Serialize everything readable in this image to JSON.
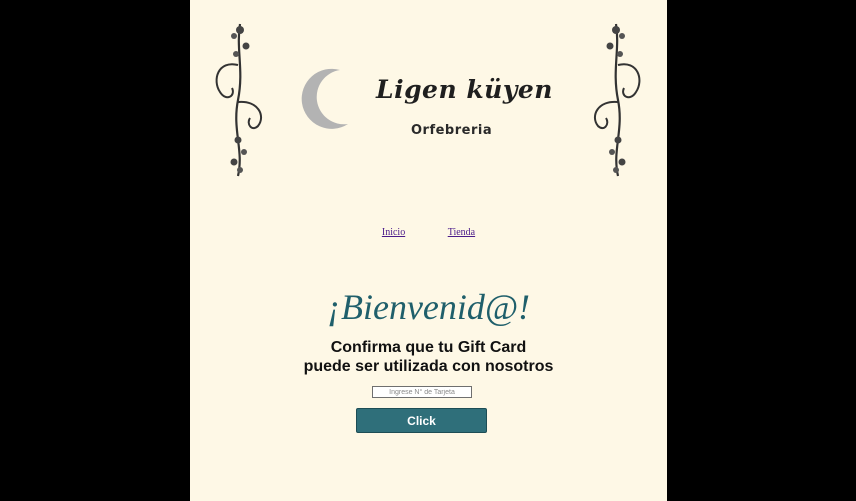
{
  "brand": {
    "name": "Ligen küyen",
    "tagline": "Orfebreria"
  },
  "nav": {
    "items": [
      {
        "label": "Inicio"
      },
      {
        "label": "Tienda"
      }
    ]
  },
  "main": {
    "welcome": "¡Bienvenid@!",
    "subtitle_line1": "Confirma que tu Gift Card",
    "subtitle_line2": "puede ser utilizada con nosotros",
    "card_input": {
      "placeholder": "Ingrese N° de Tarjeta",
      "value": ""
    },
    "submit_label": "Click"
  },
  "colors": {
    "page_background": "#fef8e6",
    "outer_background": "#000000",
    "accent": "#2f6f7a",
    "heading": "#1f5f6b",
    "link": "#4a1a8a"
  },
  "icons": [
    "moon-logo-icon",
    "vine-ornament-icon"
  ]
}
